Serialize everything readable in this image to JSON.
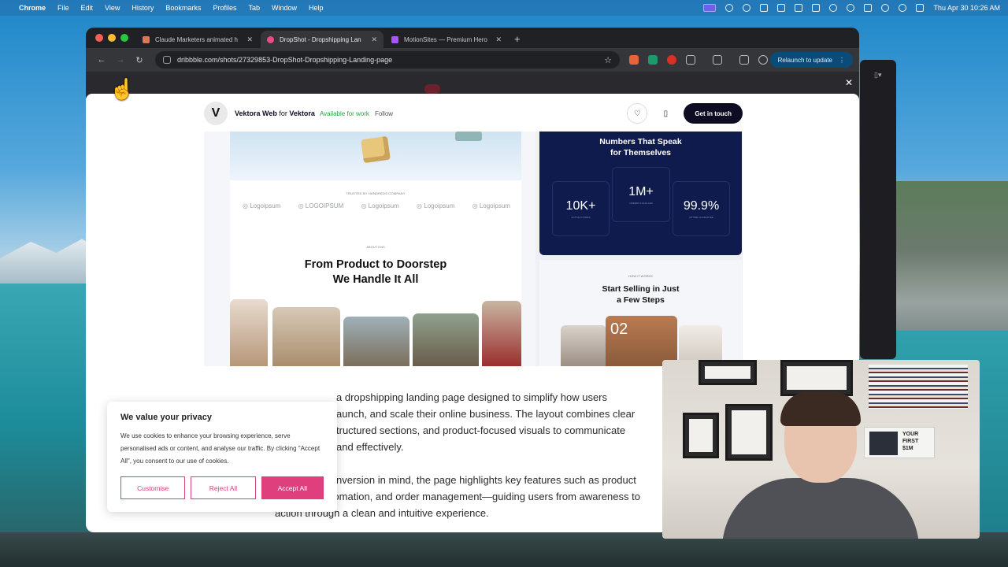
{
  "menubar": {
    "app": "Chrome",
    "items": [
      "File",
      "Edit",
      "View",
      "History",
      "Bookmarks",
      "Profiles",
      "Tab",
      "Window",
      "Help"
    ],
    "clock": "Thu Apr 30  10:26 AM"
  },
  "browser": {
    "tabs": [
      {
        "title": "Claude Marketers animated h",
        "fav_color": "#d97757"
      },
      {
        "title": "DropShot - Dropshipping Lan",
        "fav_color": "#ea4c89"
      },
      {
        "title": "MotionSites — Premium Hero",
        "fav_color": "#a855f7"
      }
    ],
    "url": "dribbble.com/shots/27329853-DropShot-Dropshipping-Landing-page",
    "relaunch_label": "Relaunch to update",
    "accent": "#0b4b78"
  },
  "shot": {
    "designer": "Vektora Web",
    "for_word": "for",
    "team": "Vektora",
    "availability": "Available for work",
    "follow_label": "Follow",
    "get_in_touch": "Get in touch",
    "avatar_letter": "V"
  },
  "preview": {
    "trusted": "TRUSTED BY HUNDREDS COMPANY",
    "logos": [
      "Logoipsum",
      "LOGOIPSUM",
      "Logoipsum",
      "Logoipsum",
      "Logoipsum"
    ],
    "about_tag": "ABOUT DNS",
    "headline_1": "From Product to Doorstep",
    "headline_2": "We Handle It All",
    "stats_title_1": "Numbers That Speak",
    "stats_title_2": "for Themselves",
    "stats": [
      {
        "value": "10K+",
        "label": "ACTIVE STORES"
      },
      {
        "value": "1M+",
        "label": "ORDERS FULFILLED"
      },
      {
        "value": "99.9%",
        "label": "UPTIME GUARANTEE"
      }
    ],
    "steps_tag": "HOW IT WORKS",
    "steps_title_1": "Start Selling in Just",
    "steps_title_2": "a Few Steps",
    "step_number": "02"
  },
  "description": {
    "p1_a": "a dropshipping landing page designed to simplify how users",
    "p1_b": "aunch, and scale their online business. The layout combines clear",
    "p1_c": "tructured sections, and product-focused visuals to communicate",
    "p1_d": "and effectively.",
    "p2_a": "nversion in mind, the page highlights key features such as product",
    "p2_b": "sourcing, automation, and order management—guiding users from awareness to",
    "p2_c": "action through a clean and intuitive experience."
  },
  "cookie": {
    "title": "We value your privacy",
    "body": "We use cookies to enhance your browsing experience, serve personalised ads or content, and analyse our traffic. By clicking \"Accept All\", you consent to our use of cookies.",
    "customise": "Customise",
    "reject": "Reject All",
    "accept": "Accept All",
    "accent": "#df3f7c"
  },
  "webcam": {
    "book_line1": "YOUR",
    "book_line2": "FIRST",
    "book_line3": "$1M"
  }
}
